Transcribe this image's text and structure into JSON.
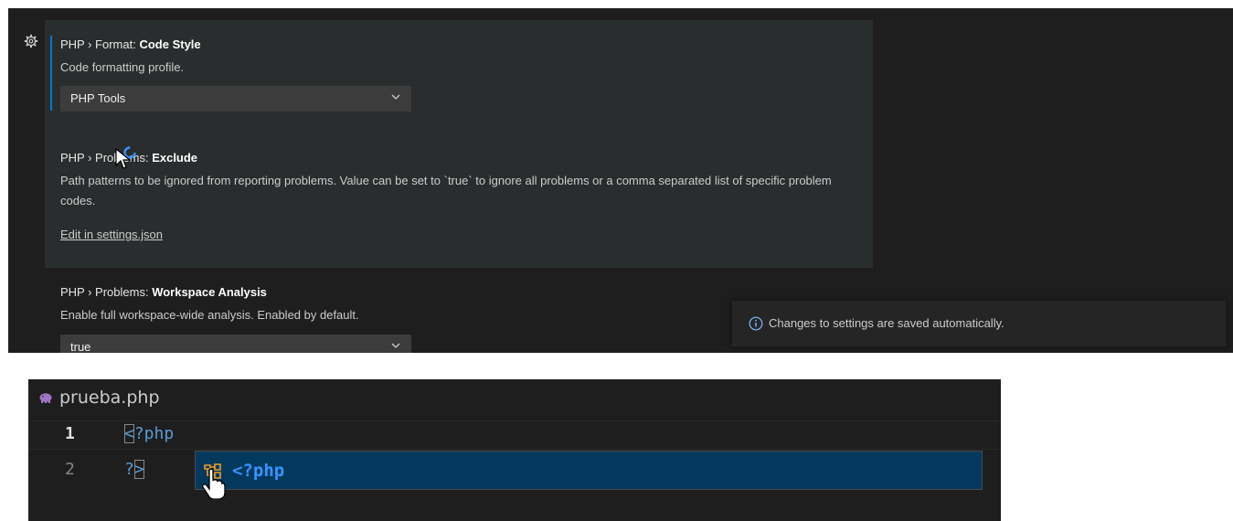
{
  "settings": [
    {
      "category": "PHP › Format: ",
      "name": "Code Style",
      "description": "Code formatting profile.",
      "value": "PHP Tools"
    },
    {
      "category": "PHP › Problems: ",
      "name": "Exclude",
      "description": "Path patterns to be ignored from reporting problems. Value can be set to `true` to ignore all problems or a comma separated list of specific problem codes.",
      "link": "Edit in settings.json"
    },
    {
      "category": "PHP › Problems: ",
      "name": "Workspace Analysis",
      "description": "Enable full workspace-wide analysis. Enabled by default.",
      "value": "true"
    }
  ],
  "toast": {
    "message": "Changes to settings are saved automatically."
  },
  "editor": {
    "filename": "prueba.php",
    "lines": [
      {
        "number": "1",
        "code_open": "<",
        "code_rest": "?php"
      },
      {
        "number": "2",
        "code_open": "?",
        "code_rest": ">"
      }
    ],
    "suggestion": "<?php"
  },
  "icons": {
    "settings_gear": "gear-icon",
    "dropdown": "chevron-down-icon",
    "info": "info-icon",
    "php_file": "php-elephant-icon",
    "snippet": "snippet-icon"
  },
  "colors": {
    "focus_accent": "#0078d4",
    "suggestion_bg": "#04395e",
    "php_keyword": "#569cd6"
  }
}
